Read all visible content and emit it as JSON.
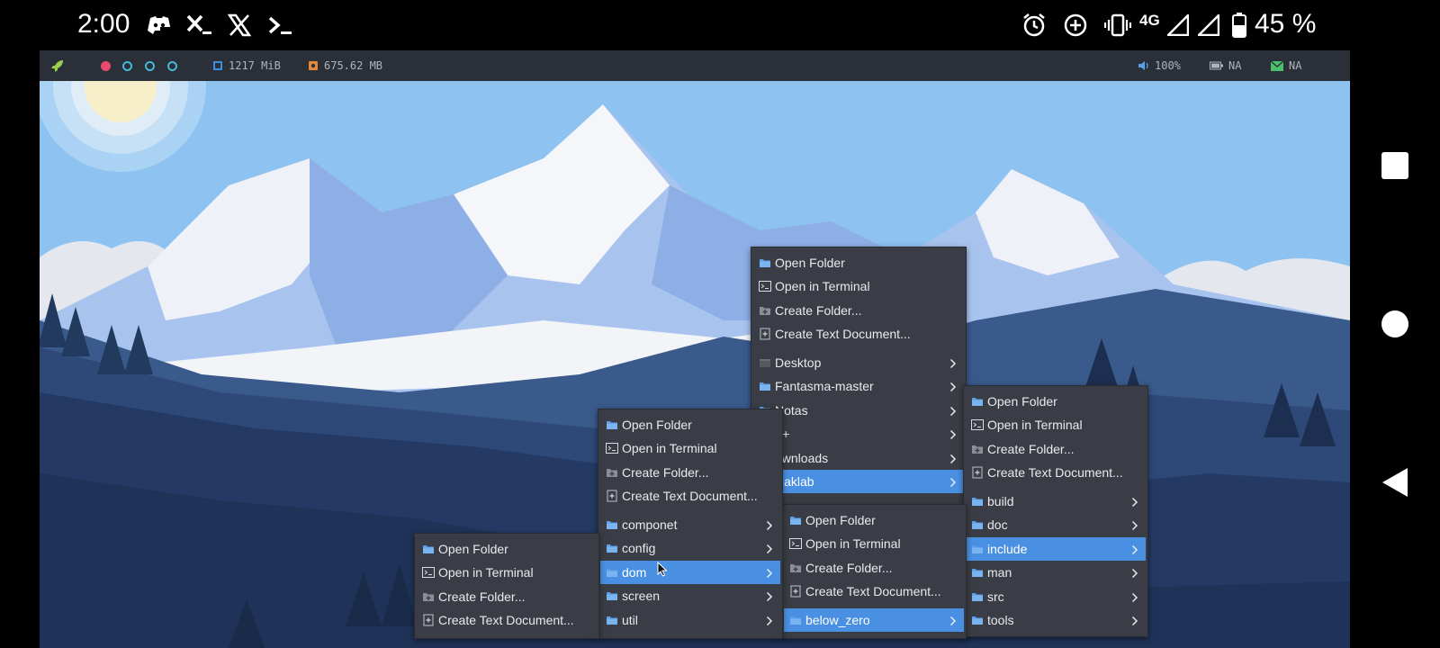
{
  "status_bar": {
    "time": "2:00",
    "left_icons": [
      "discord-icon",
      "terminal-x-icon",
      "x-logo-icon",
      "terminal-prompt-icon"
    ],
    "right_icons": [
      "alarm-icon",
      "data-saver-icon",
      "vibrate-icon",
      "signal-icon",
      "signal-icon",
      "battery-icon"
    ],
    "network": "4G",
    "battery": "45 %"
  },
  "panel": {
    "memory": "1217 MiB",
    "disk": "675.62 MB",
    "volume": "100%",
    "battery": "NA",
    "mail": "NA",
    "colors": {
      "bg": "#2b2f38",
      "active_workspace": "#e84a6f",
      "workspace": "#43b8d8"
    }
  },
  "menus": {
    "home": {
      "actions": [
        "Open Folder",
        "Open in Terminal",
        "Create Folder...",
        "Create Text Document..."
      ],
      "folders": [
        "Desktop",
        "Fantasma-master",
        "Notas",
        "++",
        "ownloads",
        "Haklab"
      ]
    },
    "haklab": {
      "actions": [
        "Open Folder",
        "Open in Terminal",
        "Create Folder...",
        "Create Text Document..."
      ],
      "folders": [
        "build",
        "doc",
        "include",
        "man",
        "src",
        "tools"
      ]
    },
    "include": {
      "actions": [
        "Open Folder",
        "Open in Terminal",
        "Create Folder...",
        "Create Text Document..."
      ],
      "folders": [
        "below_zero"
      ]
    },
    "below_zero": {
      "actions": [
        "Open Folder",
        "Open in Terminal",
        "Create Folder...",
        "Create Text Document..."
      ],
      "folders": [
        "componet",
        "config",
        "dom",
        "screen",
        "util"
      ]
    },
    "dom": {
      "actions": [
        "Open Folder",
        "Open in Terminal",
        "Create Folder...",
        "Create Text Document..."
      ]
    }
  },
  "accent_color": "#4a90e2"
}
